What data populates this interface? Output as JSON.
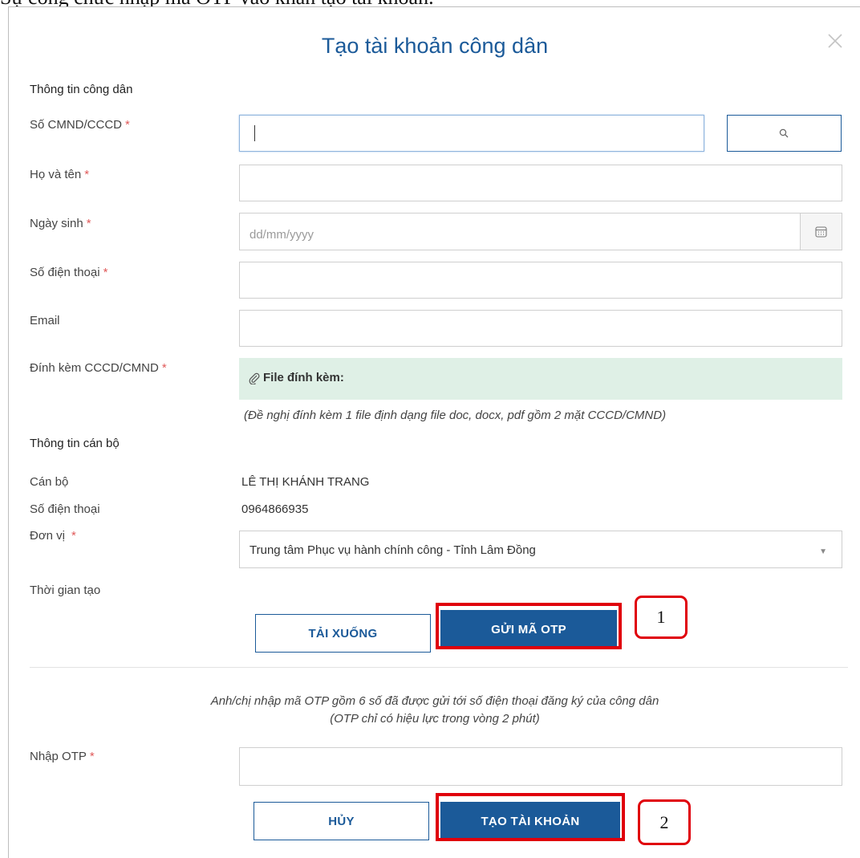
{
  "caption": "Sự công chức nhập mã OTP vào khẩn tạo tài khoản.",
  "dialog": {
    "title": "Tạo tài khoản công dân"
  },
  "citizen": {
    "section_title": "Thông tin công dân",
    "id_label": "Số CMND/CCCD",
    "name_label": "Họ và tên",
    "dob_label": "Ngày sinh",
    "dob_placeholder": "dd/mm/yyyy",
    "phone_label": "Số điện thoại",
    "email_label": "Email",
    "attach_label": "Đính kèm CCCD/CMND",
    "attach_box_label": "File đính kèm:",
    "attach_hint": "(Đề nghị đính kèm 1 file định dạng file doc, docx, pdf gồm 2 mặt CCCD/CMND)",
    "required_mark": "*"
  },
  "officer": {
    "section_title": "Thông tin cán bộ",
    "officer_label": "Cán bộ",
    "officer_value": "LÊ THỊ KHÁNH TRANG",
    "phone_label": "Số điện thoại",
    "phone_value": "0964866935",
    "unit_label": "Đơn vị",
    "unit_value": "Trung tâm Phục vụ hành chính công - Tỉnh Lâm Đồng",
    "created_label": "Thời gian tạo"
  },
  "actions": {
    "download": "TẢI XUỐNG",
    "send_otp": "GỬI MÃ OTP",
    "step1": "1",
    "cancel": "HỦY",
    "create": "TẠO TÀI KHOẢN",
    "step2": "2"
  },
  "otp": {
    "notice_line1": "Anh/chị nhập mã OTP gồm 6 số đã được gửi tới số điện thoại đăng ký của công dân",
    "notice_line2": "(OTP chỉ có hiệu lực trong vòng 2 phút)",
    "label": "Nhập OTP"
  },
  "colors": {
    "primary": "#1b5a99",
    "highlight": "#e0000b",
    "attach_bg": "#dff0e6",
    "required": "#e05a5a"
  }
}
